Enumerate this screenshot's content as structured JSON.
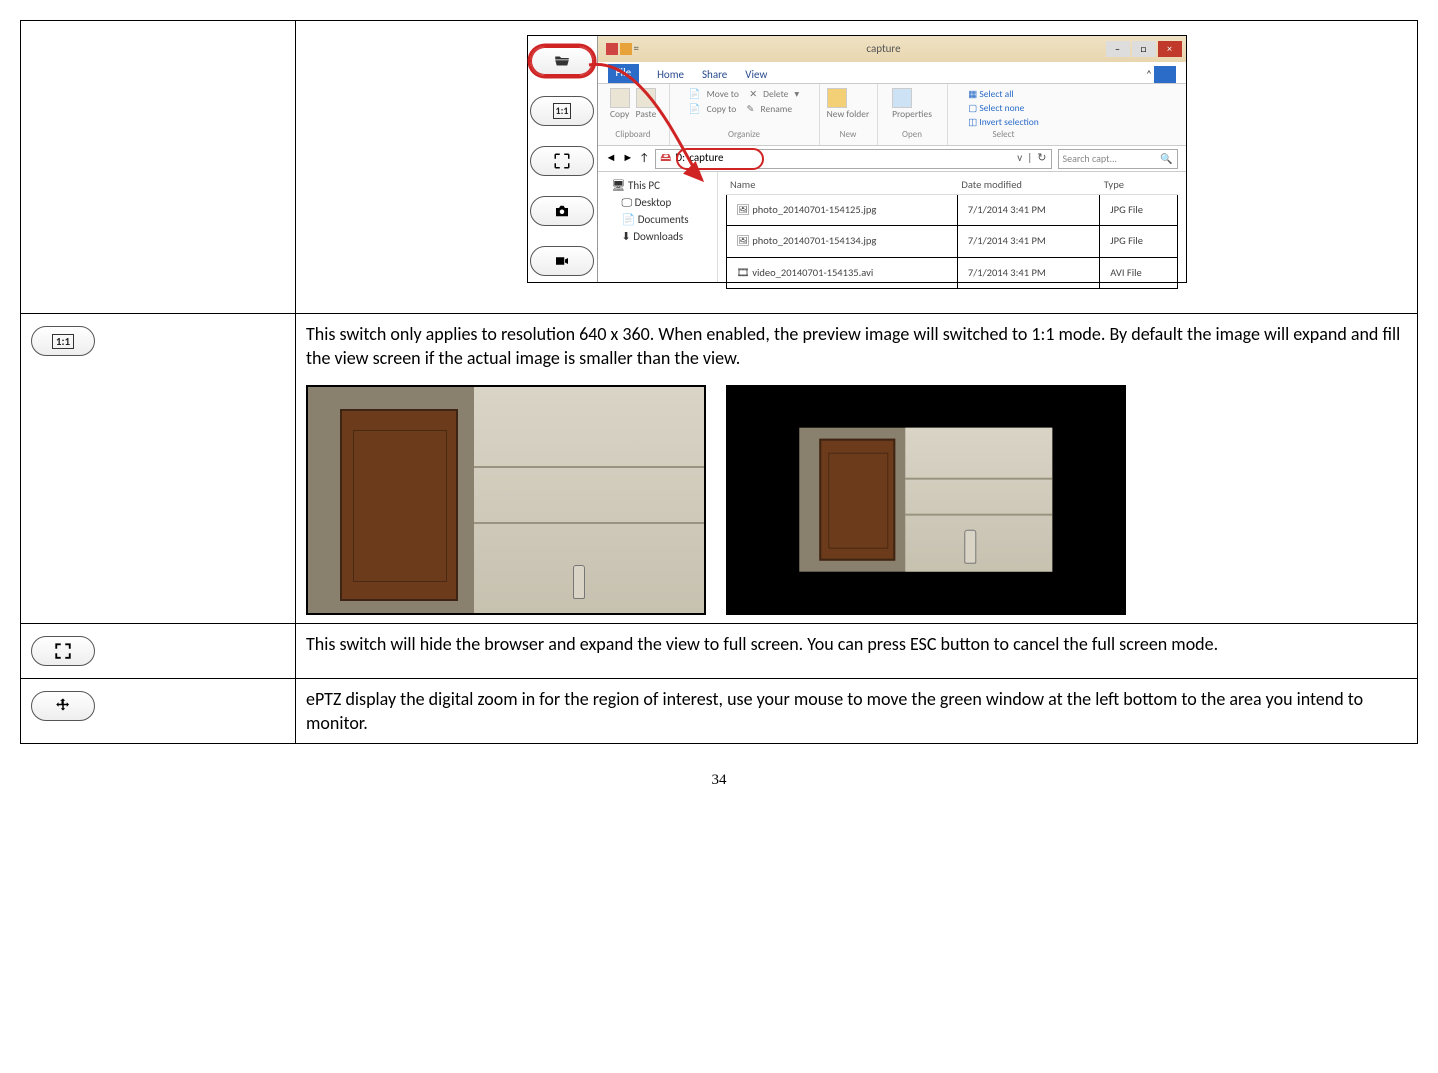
{
  "page_number": "34",
  "row1": {
    "sidebar_icons": [
      "folder-open-icon",
      "one-to-one-icon",
      "fullscreen-icon",
      "camera-icon",
      "record-icon"
    ],
    "explorer": {
      "title": "capture",
      "tabs": {
        "file": "File",
        "home": "Home",
        "share": "Share",
        "view": "View"
      },
      "ribbon": {
        "clipboard": {
          "copy": "Copy",
          "paste": "Paste",
          "group": "Clipboard"
        },
        "organize": {
          "moveto": "Move to",
          "copyto": "Copy to",
          "delete": "Delete",
          "rename": "Rename",
          "group": "Organize"
        },
        "new_": {
          "newfolder": "New folder",
          "group": "New"
        },
        "open": {
          "properties": "Properties",
          "group": "Open"
        },
        "select": {
          "all": "Select all",
          "none": "Select none",
          "invert": "Invert selection",
          "group": "Select"
        }
      },
      "address_path": "D:\\capture",
      "search_placeholder": "Search capt...",
      "nav": {
        "thispc": "This PC",
        "desktop": "Desktop",
        "documents": "Documents",
        "downloads": "Downloads"
      },
      "columns": {
        "name": "Name",
        "date": "Date modified",
        "type": "Type"
      },
      "files": [
        {
          "name": "photo_20140701-154125.jpg",
          "date": "7/1/2014 3:41 PM",
          "type": "JPG File"
        },
        {
          "name": "photo_20140701-154134.jpg",
          "date": "7/1/2014 3:41 PM",
          "type": "JPG File"
        },
        {
          "name": "video_20140701-154135.avi",
          "date": "7/1/2014 3:41 PM",
          "type": "AVI File"
        }
      ]
    }
  },
  "row2": {
    "icon_label": "1:1",
    "text": "This switch only applies to resolution 640 x 360. When enabled, the preview image will switched to 1:1 mode. By default the image will expand and fill the view screen if the actual image is smaller than the view."
  },
  "row3": {
    "text": "This switch will hide the browser and expand the view to full screen. You can press ESC button to cancel the full screen mode."
  },
  "row4": {
    "text": "ePTZ display the digital zoom in for the region of interest, use your mouse to move the green window at the left bottom to the area you intend to monitor."
  }
}
